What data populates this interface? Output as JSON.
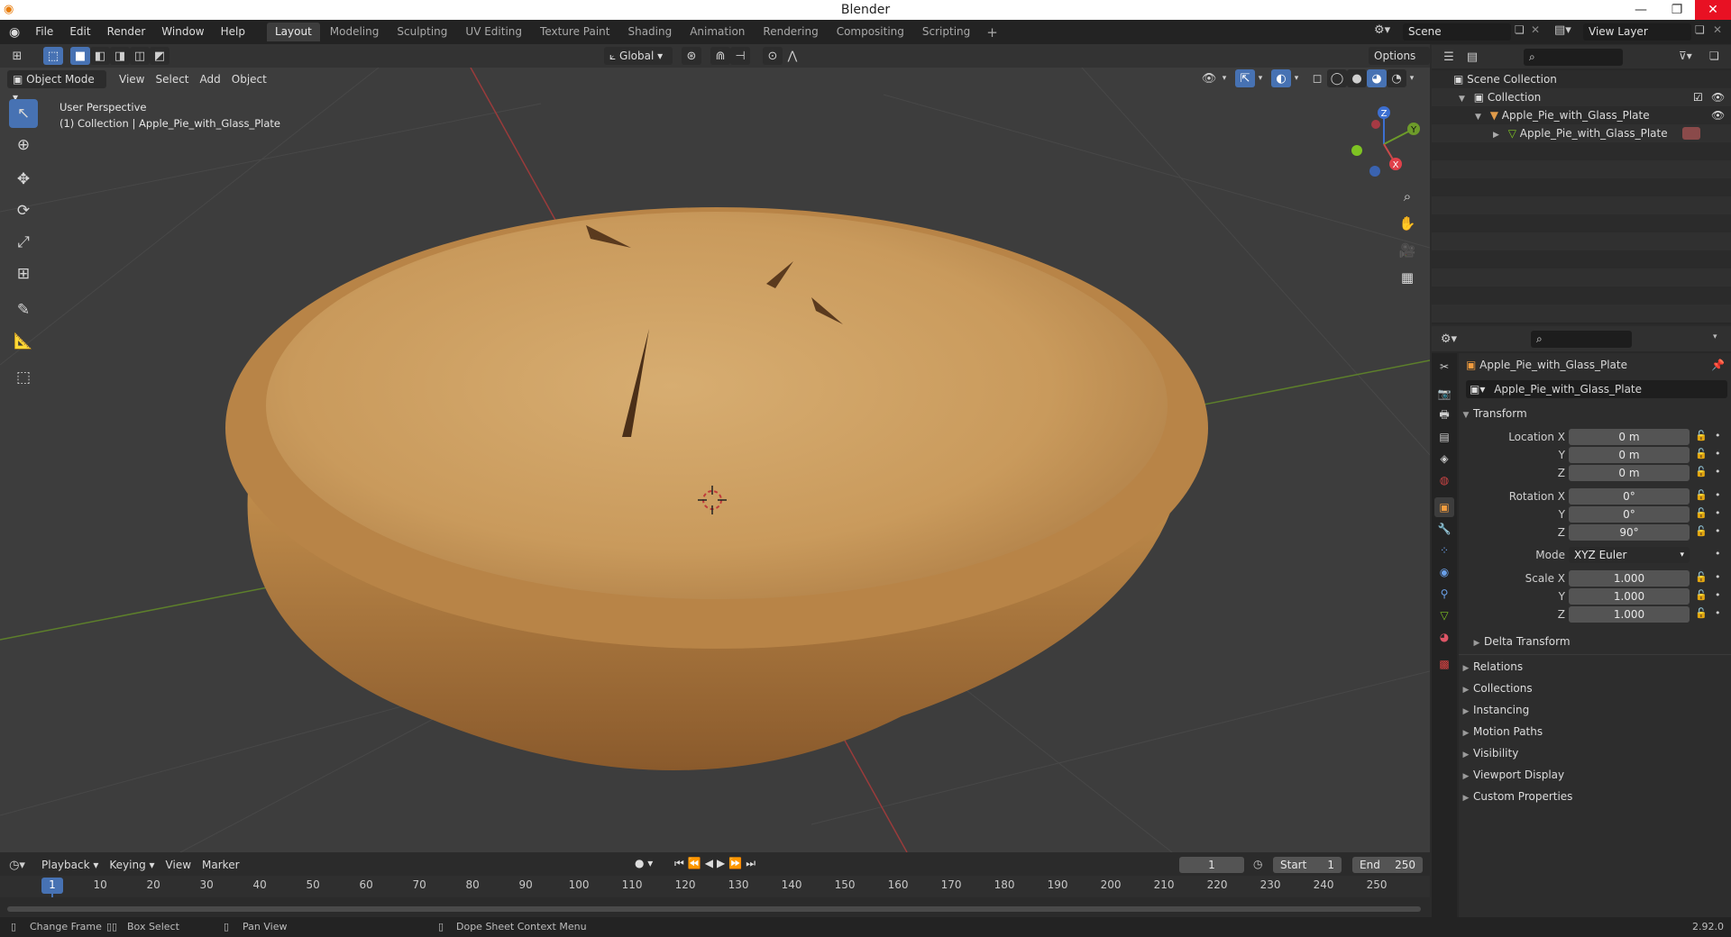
{
  "window": {
    "title": "Blender"
  },
  "menus": [
    "File",
    "Edit",
    "Render",
    "Window",
    "Help"
  ],
  "workspaces": [
    "Layout",
    "Modeling",
    "Sculpting",
    "UV Editing",
    "Texture Paint",
    "Shading",
    "Animation",
    "Rendering",
    "Compositing",
    "Scripting"
  ],
  "active_workspace": "Layout",
  "scene_field": "Scene",
  "view_layer_field": "View Layer",
  "viewport": {
    "mode": "Object Mode",
    "header_menus": [
      "View",
      "Select",
      "Add",
      "Object"
    ],
    "transform_orientation": "Global",
    "options_label": "Options",
    "overlay_line1": "User Perspective",
    "overlay_line2": "(1) Collection | Apple_Pie_with_Glass_Plate",
    "gizmo": {
      "x": "X",
      "y": "Y",
      "z": "Z"
    }
  },
  "outliner": {
    "scene_collection": "Scene Collection",
    "collection": "Collection",
    "object": "Apple_Pie_with_Glass_Plate",
    "mesh": "Apple_Pie_with_Glass_Plate"
  },
  "properties": {
    "object_name": "Apple_Pie_with_Glass_Plate",
    "datablock_name": "Apple_Pie_with_Glass_Plate",
    "transform_title": "Transform",
    "location_label": "Location X",
    "rotation_label": "Rotation X",
    "scale_label": "Scale X",
    "axis_y": "Y",
    "axis_z": "Z",
    "location": [
      "0 m",
      "0 m",
      "0 m"
    ],
    "rotation": [
      "0°",
      "0°",
      "90°"
    ],
    "mode_label": "Mode",
    "mode_value": "XYZ Euler",
    "scale": [
      "1.000",
      "1.000",
      "1.000"
    ],
    "delta_transform": "Delta Transform",
    "sections": [
      "Relations",
      "Collections",
      "Instancing",
      "Motion Paths",
      "Visibility",
      "Viewport Display",
      "Custom Properties"
    ]
  },
  "timeline": {
    "menus": [
      "Playback",
      "Keying",
      "View",
      "Marker"
    ],
    "current_frame": "1",
    "start_label": "Start",
    "start_value": "1",
    "end_label": "End",
    "end_value": "250",
    "ruler_ticks": [
      "1",
      "10",
      "20",
      "30",
      "40",
      "50",
      "60",
      "70",
      "80",
      "90",
      "100",
      "110",
      "120",
      "130",
      "140",
      "150",
      "160",
      "170",
      "180",
      "190",
      "200",
      "210",
      "220",
      "230",
      "240",
      "250"
    ]
  },
  "statusbar": {
    "change_frame": "Change Frame",
    "box_select": "Box Select",
    "pan_view": "Pan View",
    "context_menu": "Dope Sheet Context Menu",
    "version": "2.92.0"
  },
  "colors": {
    "accent": "#4772b3",
    "x_axis": "#c94a4a",
    "y_axis": "#6d9b2a",
    "pie": "#c99a5c"
  }
}
